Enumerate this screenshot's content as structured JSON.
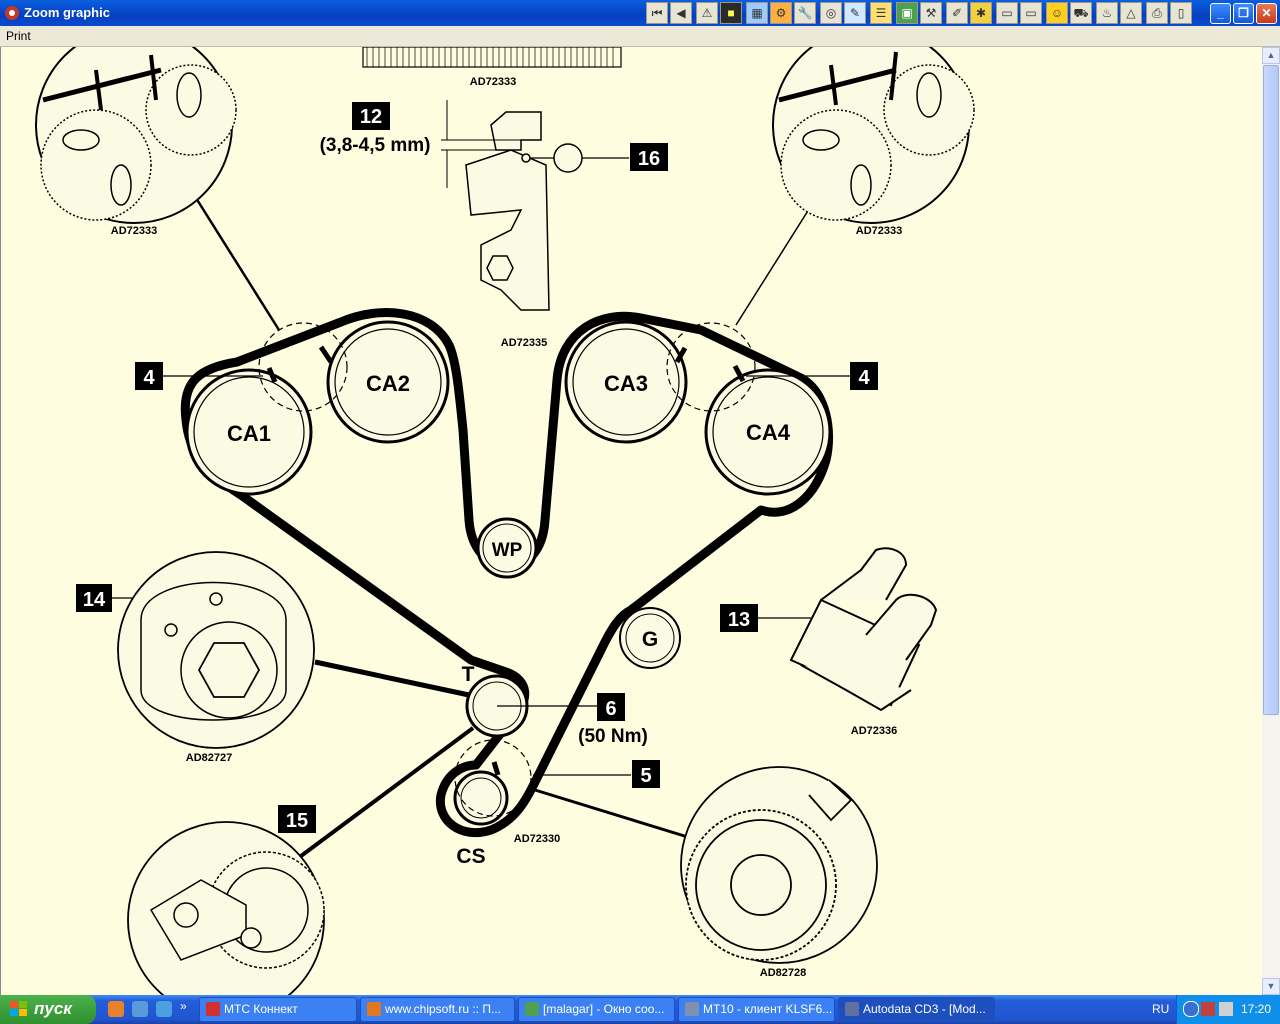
{
  "window": {
    "title": "Zoom graphic",
    "menu_print": "Print"
  },
  "toolbar": {
    "icons": [
      "first-icon",
      "prev-icon",
      "warning-icon",
      "color-icon",
      "image-icon",
      "gear-icon",
      "wrench-icon",
      "disc-icon",
      "zoom-icon",
      "list-icon",
      "save-icon",
      "tool-icon",
      "brush-icon",
      "bug-icon",
      "blank-icon",
      "blank2-icon",
      "smiley-icon",
      "car-icon",
      "lamp-icon",
      "triangle-icon",
      "print-icon",
      "battery-icon"
    ]
  },
  "diagram": {
    "codes": {
      "top_center": "AD72333",
      "top_left": "AD72333",
      "top_right": "AD72333",
      "tensioner": "AD72335",
      "left_tool": "AD82727",
      "clip": "AD72336",
      "crank": "AD72330",
      "right_crank": "AD82728"
    },
    "pulleys": {
      "ca1": "CA1",
      "ca2": "CA2",
      "ca3": "CA3",
      "ca4": "CA4",
      "wp": "WP",
      "g": "G",
      "t": "T",
      "cs": "CS"
    },
    "callouts": {
      "n12": "12",
      "n12_value": "(3,8-4,5 mm)",
      "n16": "16",
      "n4_left": "4",
      "n4_right": "4",
      "n14": "14",
      "n13": "13",
      "n6": "6",
      "n6_value": "(50 Nm)",
      "n5": "5",
      "n15": "15"
    }
  },
  "taskbar": {
    "start": "пуск",
    "tasks": [
      {
        "label": "МТС Коннект",
        "color": "#d03030",
        "active": false
      },
      {
        "label": "www.chipsoft.ru :: П...",
        "color": "#e07820",
        "active": false
      },
      {
        "label": "[malagar] - Окно соо...",
        "color": "#50a050",
        "active": false
      },
      {
        "label": "MT10 - клиент KLSF6...",
        "color": "#8090b0",
        "active": false
      },
      {
        "label": "Autodata CD3 - [Mod...",
        "color": "#6070a0",
        "active": true
      }
    ],
    "lang": "RU",
    "clock": "17:20"
  },
  "colors": {
    "canvas_bg": "#fefde0",
    "pulley_fill": "#fbfbe4",
    "ink": "#000000"
  }
}
